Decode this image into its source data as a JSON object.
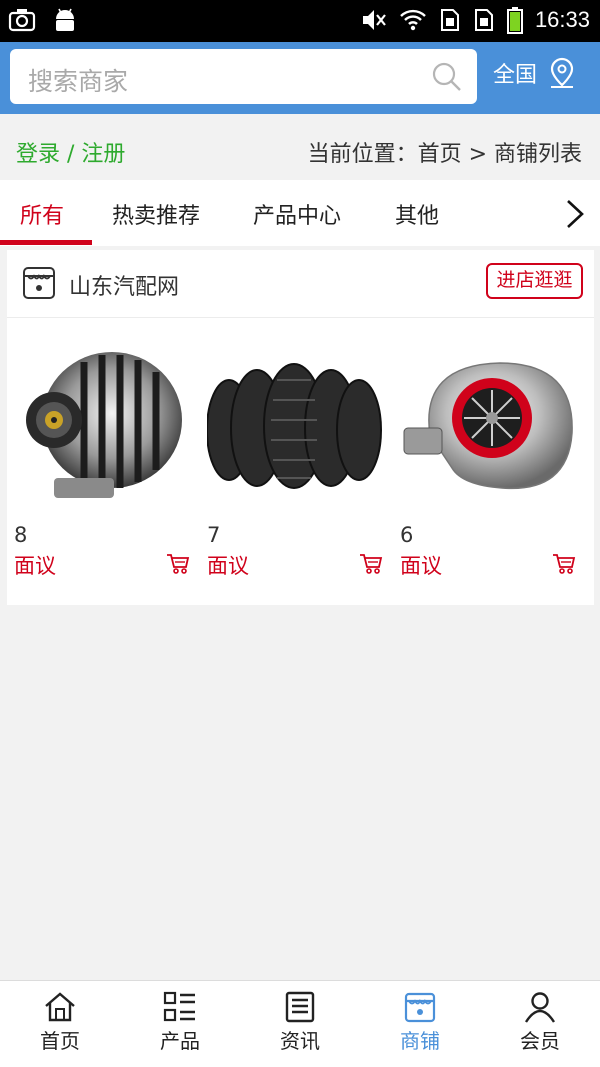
{
  "statusbar": {
    "time": "16:33"
  },
  "search": {
    "placeholder": "搜索商家"
  },
  "region": {
    "label": "全国"
  },
  "breadcrumb": {
    "login": "登录 / 注册",
    "location": "当前位置：首页 > 商铺列表"
  },
  "tabs": [
    {
      "label": "所有",
      "active": true
    },
    {
      "label": "热卖推荐"
    },
    {
      "label": "产品中心"
    },
    {
      "label": "其他"
    }
  ],
  "shop": {
    "name": "山东汽配网",
    "enter_label": "进店逛逛",
    "products": [
      {
        "name": "8",
        "price": "面议",
        "image": "alternator"
      },
      {
        "name": "7",
        "price": "面议",
        "image": "tires"
      },
      {
        "name": "6",
        "price": "面议",
        "image": "turbocharger"
      }
    ]
  },
  "bottom_nav": [
    {
      "label": "首页",
      "icon": "home-icon"
    },
    {
      "label": "产品",
      "icon": "grid-list-icon"
    },
    {
      "label": "资讯",
      "icon": "news-icon"
    },
    {
      "label": "商铺",
      "icon": "shop-icon",
      "active": true
    },
    {
      "label": "会员",
      "icon": "user-icon"
    }
  ],
  "colors": {
    "brand": "#4a90d9",
    "accent_red": "#d0021b",
    "login_green": "#2eaa2e"
  }
}
